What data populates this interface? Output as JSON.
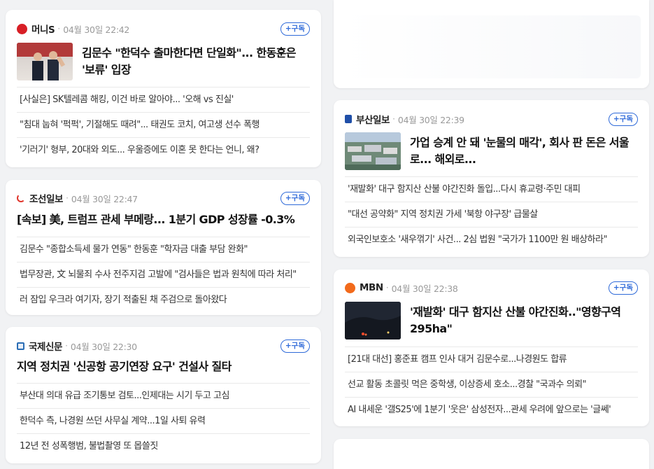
{
  "subscribe_label": "+구독",
  "cards": [
    {
      "publisher": "머니S",
      "logo_color": "#d81f26",
      "time": "04월 30일 22:42",
      "lead": "김문수 \"한덕수 출마한다면 단일화\"... 한동훈은 '보류' 입장",
      "items": [
        "[사실은] SK텔레콤 해킹, 이건 바로 알아야... '오해 vs 진실'",
        "\"침대 눕혀 '퍽퍽', 기절해도 때려\"... 태권도 코치, 여고생 선수 폭행",
        "'기러기' 형부, 20대와 외도... 우울증에도 이혼 못 한다는 언니, 왜?"
      ]
    },
    {
      "publisher": "조선일보",
      "logo_color": "#e0342a",
      "time": "04월 30일 22:47",
      "lead": "[속보] 美, 트럼프 관세 부메랑... 1분기 GDP 성장률 -0.3%",
      "items": [
        "김문수 \"종합소득세 물가 연동\" 한동훈 \"학자금 대출 부담 완화\"",
        "법무장관, 文 뇌물죄 수사 전주지검 고발에 \"검사들은 법과 원칙에 따라 처리\"",
        "러 잠입 우크라 여기자, 장기 적출된 채 주검으로 돌아왔다"
      ]
    },
    {
      "publisher": "국제신문",
      "logo_color": "#2a6db5",
      "time": "04월 30일 22:30",
      "lead": "지역 정치권 '신공항 공기연장 요구' 건설사 질타",
      "items": [
        "부산대 의대 유급 조기통보 검토...인제대는 시기 두고 고심",
        "한덕수 측, 나경원 쓰던 사무실 계약...1일 사퇴 유력",
        "12년 전 성폭행범, 불법촬영 또 몹쓸짓"
      ]
    },
    {
      "publisher": "부산일보",
      "logo_color": "#1f4fa8",
      "time": "04월 30일 22:39",
      "lead": "가업 승계 안 돼 '눈물의 매각', 회사 판 돈은 서울로... 해외로...",
      "items": [
        "'재발화' 대구 함지산 산불 야간진화 돌입...다시 휴교령·주민 대피",
        "\"대선 공약화\" 지역 정치권 가세 '북항 야구장' 급물살",
        "외국인보호소 '새우꺾기' 사건... 2심 법원 \"국가가 1100만 원 배상하라\""
      ]
    },
    {
      "publisher": "MBN",
      "logo_color": "#f26a1b",
      "time": "04월 30일 22:38",
      "lead": "'재발화' 대구 함지산 산불 야간진화..\"영향구역 295ha\"",
      "items": [
        "[21대 대선] 홍준표 캠프 인사 대거 김문수로...나경원도 합류",
        "선교 활동 초콜릿 먹은 중학생, 이상증세 호소...경찰 \"국과수 의뢰\"",
        "AI 내세운 '갤S25'에 1분기 '웃은' 삼성전자...관세 우려에 앞으로는 '글쎄'"
      ]
    }
  ]
}
